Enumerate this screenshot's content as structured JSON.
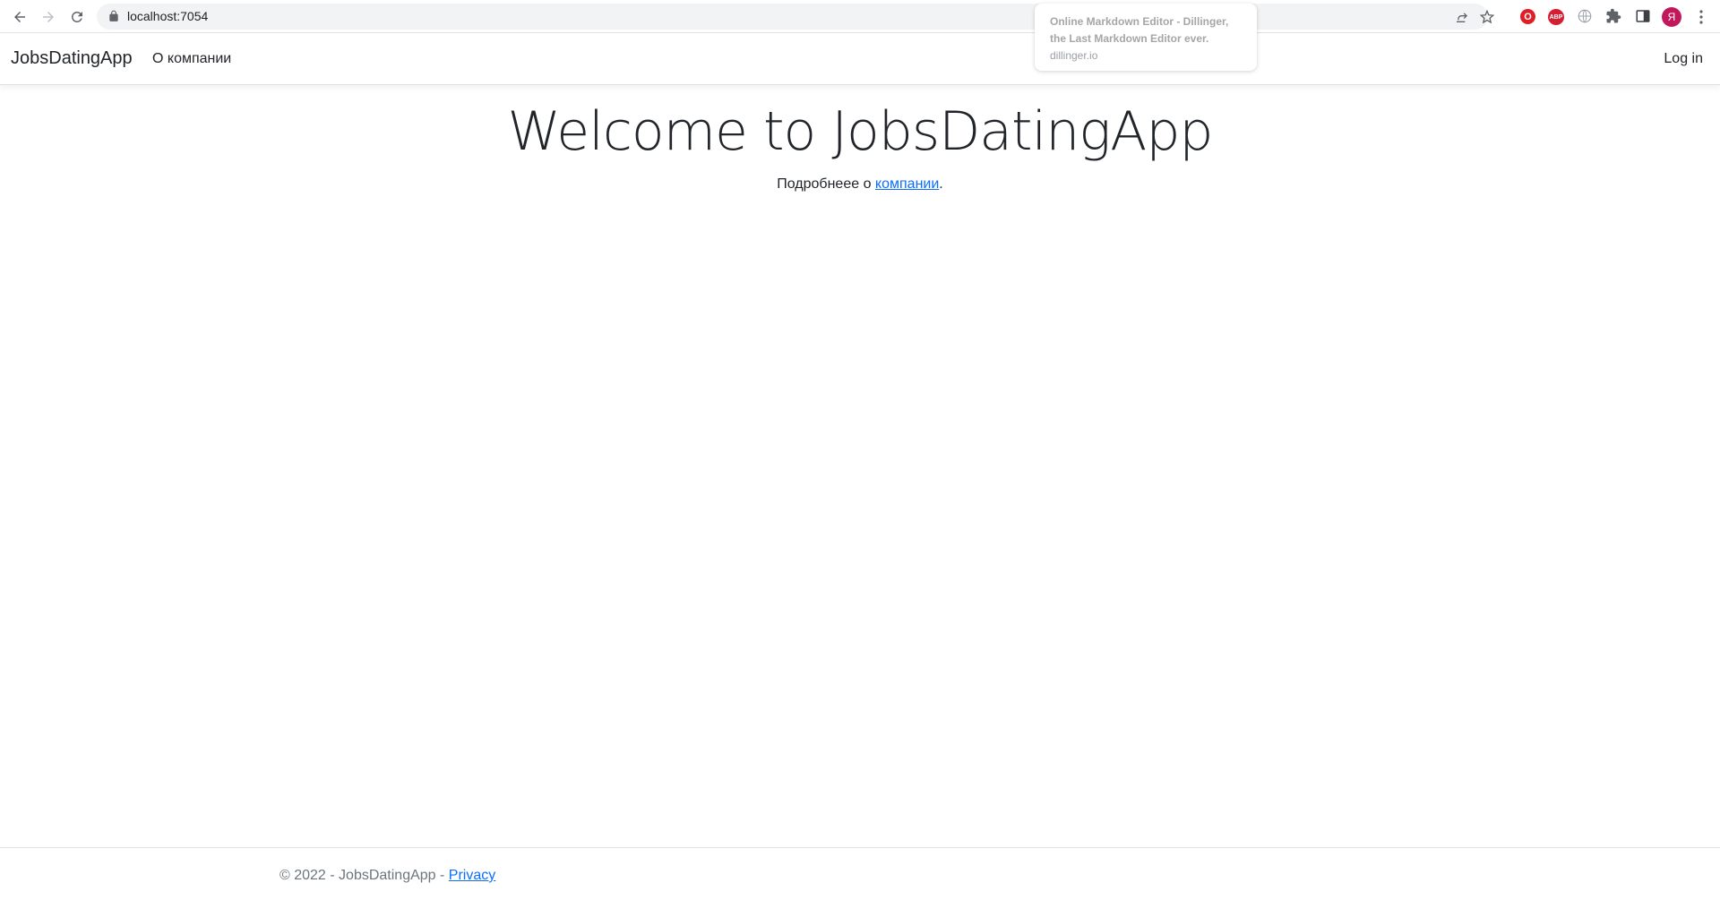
{
  "browser": {
    "url": "localhost:7054",
    "tooltip": {
      "title_line1": "Online Markdown Editor - Dillinger,",
      "title_line2": "the Last Markdown Editor ever.",
      "site": "dillinger.io"
    },
    "avatar_letter": "Я",
    "extensions": [
      "opera-icon",
      "adblock-plus-icon",
      "globe-icon",
      "puzzle-icon",
      "sidepanel-icon"
    ],
    "abp_label": "ABP"
  },
  "navbar": {
    "brand": "JobsDatingApp",
    "about_link": "О компании",
    "login": "Log in"
  },
  "main": {
    "title": "Welcome to JobsDatingApp",
    "lead_prefix": "Подробнеее о ",
    "lead_link": "компании",
    "lead_suffix": "."
  },
  "footer": {
    "copyright": "© 2022 - JobsDatingApp - ",
    "privacy": "Privacy"
  },
  "colors": {
    "link": "#0d6efd",
    "text": "#212529",
    "muted": "#6c757d",
    "avatar": "#c2185b"
  }
}
